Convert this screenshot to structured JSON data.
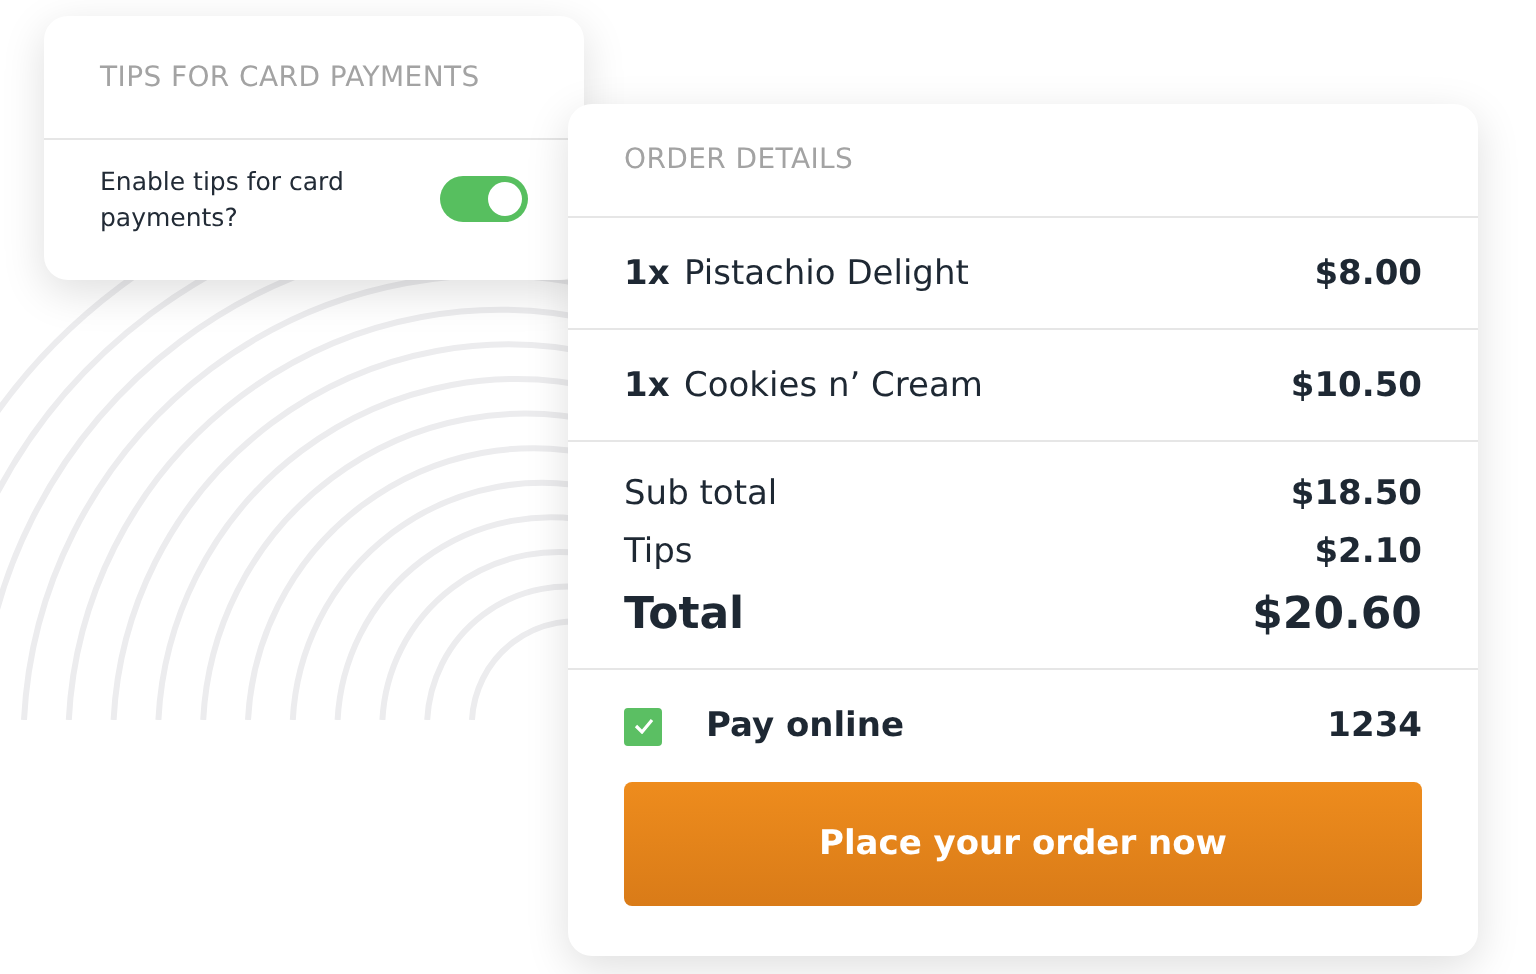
{
  "tips_card": {
    "title": "TIPS FOR CARD PAYMENTS",
    "setting": {
      "label": "Enable tips for card payments?",
      "on": true
    }
  },
  "order_card": {
    "title": "ORDER DETAILS",
    "items": [
      {
        "quantity": "1x",
        "name": "Pistachio Delight",
        "price": "$8.00"
      },
      {
        "quantity": "1x",
        "name": "Cookies n’ Cream",
        "price": "$10.50"
      }
    ],
    "totals": [
      {
        "kind": "minor",
        "label": "Sub total",
        "amount": "$18.50"
      },
      {
        "kind": "minor",
        "label": "Tips",
        "amount": "$2.10"
      },
      {
        "kind": "major",
        "label": "Total",
        "amount": "$20.60"
      }
    ],
    "payment": {
      "label": "Pay online",
      "checked": true,
      "code": "1234"
    },
    "button": "Place your order now"
  }
}
